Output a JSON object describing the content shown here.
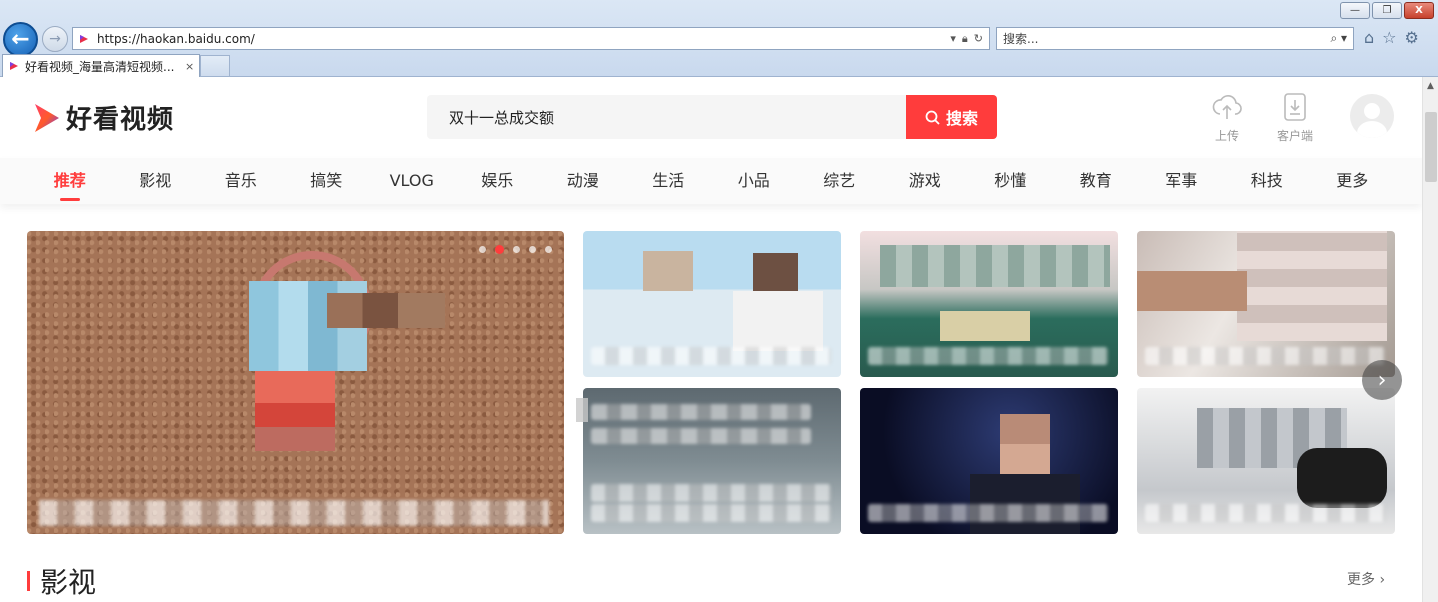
{
  "browser": {
    "url": "https://haokan.baidu.com/",
    "search_placeholder": "搜索...",
    "tab_title": "好看视频_海量高清短视频...",
    "tab_close": "×",
    "back_symbol": "←",
    "forward_symbol": "→",
    "window_buttons": {
      "minimize": "—",
      "restore": "❐",
      "close": "X"
    }
  },
  "site": {
    "logo_text": "好看视频",
    "search_query": "双十一总成交额",
    "search_button": "搜索",
    "actions": {
      "upload": "上传",
      "client": "客户端"
    },
    "brand_color": "#ff3c3c"
  },
  "categories": {
    "items": [
      "推荐",
      "影视",
      "音乐",
      "搞笑",
      "VLOG",
      "娱乐",
      "动漫",
      "生活",
      "小品",
      "综艺",
      "游戏",
      "秒懂",
      "教育",
      "军事",
      "科技",
      "更多"
    ],
    "active": "推荐"
  },
  "feed": {
    "hero_caption": "",
    "carousel_active_dot": 2
  },
  "section": {
    "title": "影视",
    "more": "更多 ›"
  },
  "icons": {
    "back": "back-arrow-icon",
    "forward": "forward-arrow-icon",
    "upload": "cloud-upload-icon",
    "client": "download-client-icon",
    "search": "magnifier-icon"
  }
}
